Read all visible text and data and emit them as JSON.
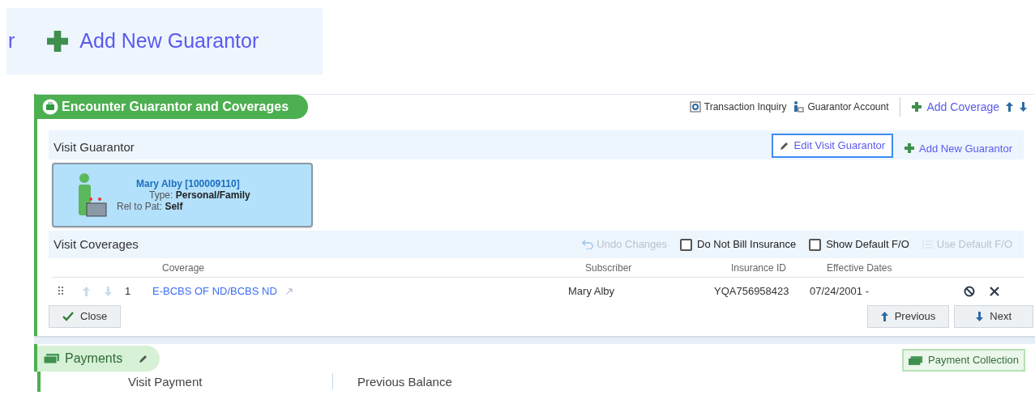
{
  "callout": {
    "cut_text": "r",
    "link": "Add New Guarantor"
  },
  "section": {
    "title": "Encounter Guarantor and Coverages",
    "actions": [
      "Transaction Inquiry",
      "Guarantor Account"
    ],
    "add_coverage": "Add Coverage"
  },
  "guarantor": {
    "heading": "Visit Guarantor",
    "edit_button": "Edit Visit Guarantor",
    "add_link": "Add New Guarantor",
    "card": {
      "name": "Mary Alby [100009110]",
      "fields": [
        {
          "label": "Type:",
          "value": "Personal/Family"
        },
        {
          "label": "Rel to Pat:",
          "value": "Self"
        }
      ]
    }
  },
  "coverages": {
    "heading": "Visit Coverages",
    "undo": {
      "label": "Undo Changes",
      "disabled": true
    },
    "checkboxes": [
      {
        "label": "Do Not Bill Insurance",
        "checked": false
      },
      {
        "label": "Show Default F/O",
        "checked": false
      }
    ],
    "use_default": {
      "label": "Use Default F/O",
      "disabled": true
    },
    "columns": [
      "Coverage",
      "Subscriber",
      "Insurance ID",
      "Effective Dates"
    ],
    "rows": [
      {
        "index": "1",
        "coverage": "E-BCBS OF ND/BCBS ND",
        "subscriber": "Mary Alby",
        "insurance_id": "YQA756958423",
        "effective_dates": "07/24/2001 -"
      }
    ]
  },
  "buttons": {
    "close": "Close",
    "previous": "Previous",
    "next": "Next"
  },
  "payments": {
    "title": "Payments",
    "collection": "Payment Collection",
    "labels": [
      "Visit Payment",
      "Previous Balance"
    ]
  }
}
